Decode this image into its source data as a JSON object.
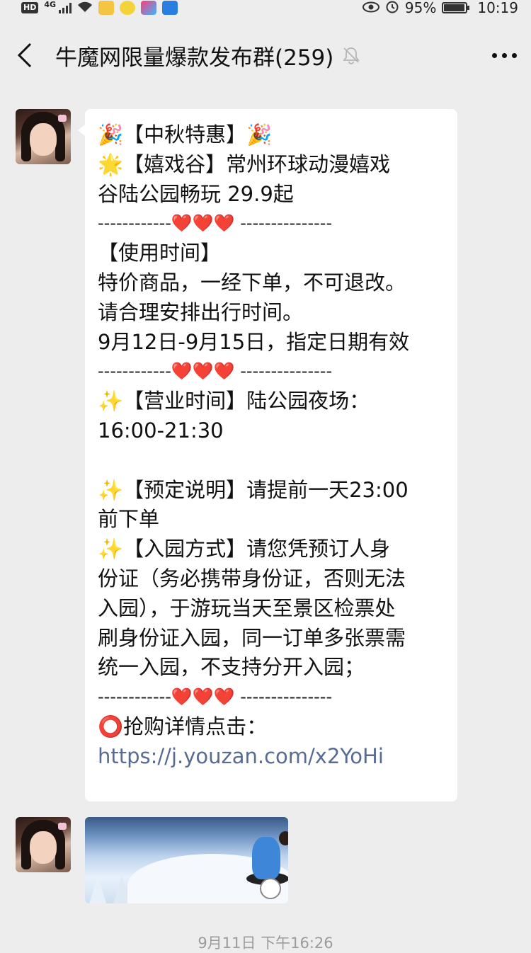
{
  "status_bar": {
    "hd": "HD",
    "network": "4G",
    "battery_percent": "95%",
    "battery_level": 0.95,
    "time": "10:19",
    "icons": [
      "hd-icon",
      "signal-icon",
      "wifi-icon",
      "app-icon",
      "app-icon",
      "app-icon",
      "app-icon",
      "eye-icon",
      "alarm-icon",
      "battery-icon"
    ]
  },
  "header": {
    "title": "牛魔网限量爆款发布群(259)",
    "icons": [
      "back-arrow-icon",
      "mute-bell-icon",
      "more-dots-icon"
    ]
  },
  "message": {
    "lines": [
      "🎉【中秋特惠】🎉",
      "🌟【嬉戏谷】常州环球动漫嬉戏",
      "谷陆公园畅玩 29.9起",
      "------------❤️❤️❤️ ---------------",
      "【使用时间】",
      "特价商品，一经下单，不可退改。",
      "请合理安排出行时间。",
      "9月12日-9月15日，指定日期有效",
      "------------❤️❤️❤️ ---------------",
      "✨【营业时间】陆公园夜场：",
      "16:00-21:30",
      "",
      "✨【预定说明】请提前一天23:00",
      "前下单",
      "✨【入园方式】请您凭预订人身",
      "份证（务必携带身份证，否则无法",
      "入园），于游玩当天至景区检票处",
      "刷身份证入园，同一订单多张票需",
      "统一入园，不支持分开入园；",
      "------------❤️❤️❤️ ---------------",
      "⭕抢购详情点击："
    ],
    "link": "https://j.youzan.com/x2YoHi"
  },
  "timestamp": "9月11日 下午16:26",
  "colors": {
    "background": "#ededed",
    "bubble": "#ffffff",
    "link": "#576b95",
    "heart": "#e0242c"
  }
}
